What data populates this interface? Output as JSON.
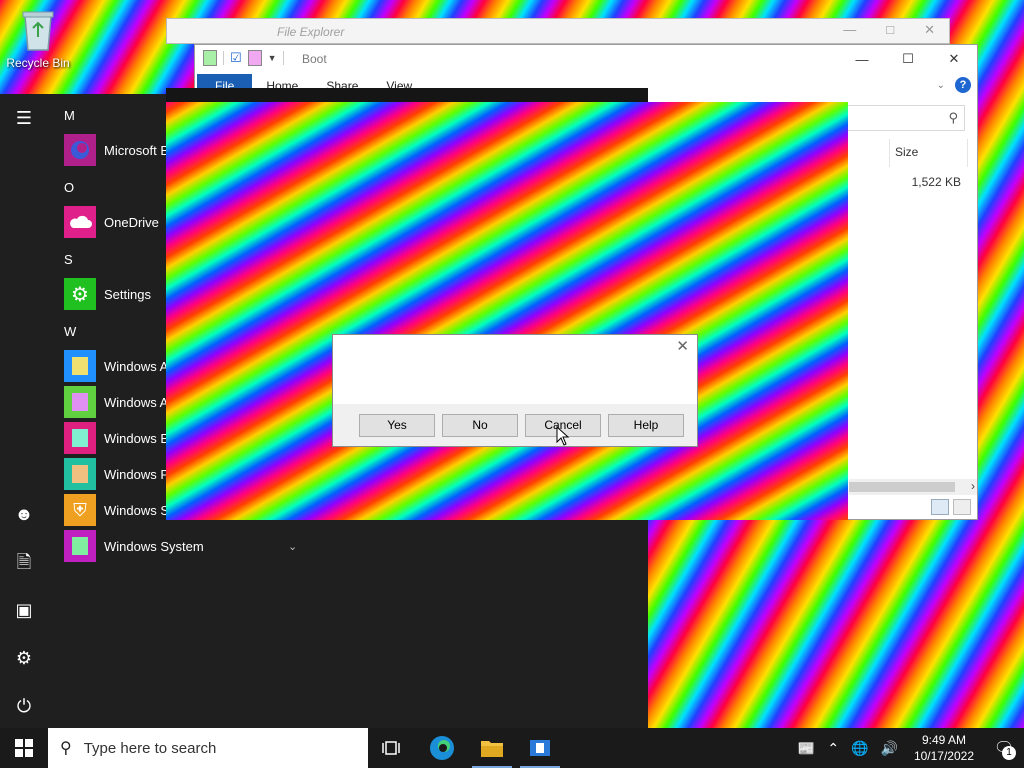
{
  "desktop": {
    "recycle_bin_label": "Recycle Bin"
  },
  "explorer_back": {
    "title": "File Explorer"
  },
  "explorer": {
    "title": "Boot",
    "tabs": [
      "File",
      "Home",
      "Share",
      "View"
    ],
    "columns": {
      "size": "Size"
    },
    "rows": [
      {
        "size": "1,522 KB"
      }
    ]
  },
  "start_menu": {
    "letters": {
      "m": "M",
      "o": "O",
      "s": "S",
      "w": "W"
    },
    "apps": {
      "edge": "Microsoft Ec",
      "onedrive": "OneDrive",
      "settings": "Settings",
      "win_acc1": "Windows Ac",
      "win_acc2": "Windows Ac",
      "win_ease": "Windows Ea",
      "win_power": "Windows Po",
      "win_sec": "Windows Se",
      "win_system": "Windows System"
    }
  },
  "dialog": {
    "buttons": {
      "yes": "Yes",
      "no": "No",
      "cancel": "Cancel",
      "help": "Help"
    }
  },
  "taskbar": {
    "search_placeholder": "Type here to search",
    "time": "9:49 AM",
    "date": "10/17/2022",
    "notification_count": "1"
  },
  "colors": {
    "accent": "#1a5fb4",
    "start_menu_bg": "#1f1f1f",
    "taskbar_bg": "#1a1a1a"
  }
}
